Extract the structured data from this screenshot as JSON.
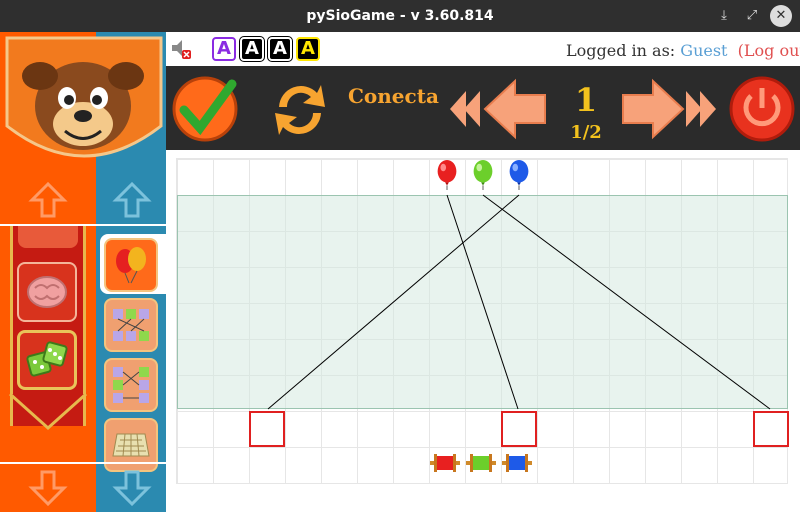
{
  "window": {
    "title": "pySioGame - v 3.60.814",
    "minimize_icon": "download-arrow-icon",
    "maximize_icon": "expand-icon",
    "close_icon": "close-icon"
  },
  "topbar": {
    "mute_icon": "speaker-muted-icon",
    "font_buttons": [
      "A",
      "A",
      "A",
      "A"
    ],
    "login_prefix": "Logged in as:",
    "username": "Guest",
    "logout": "(Log out)"
  },
  "toolbar": {
    "check_icon": "checkmark-icon",
    "refresh_icon": "refresh-icon",
    "game_title": "Conecta",
    "level": "1",
    "level_progress": "1/2",
    "prev_level_icon": "double-left-icon",
    "prev_icon": "left-arrow-icon",
    "next_icon": "right-arrow-icon",
    "next_level_icon": "double-right-icon",
    "quit_icon": "power-icon"
  },
  "sidebar": {
    "categories": [
      "brain-icon",
      "dice-icon"
    ],
    "games": [
      "balloons-icon",
      "number-connect-icon",
      "number-match-icon",
      "keyboard-grid-icon"
    ]
  },
  "colors": {
    "orange": "#ff5a00",
    "blue": "#2b8ab0",
    "toolbar_bg": "#2b2b2b",
    "title_gold": "#f7a430",
    "level_gold": "#f3c21e",
    "target_red": "#e02020"
  },
  "game": {
    "balloons": [
      "red",
      "green",
      "blue"
    ],
    "spools": [
      "red",
      "green",
      "blue"
    ]
  }
}
